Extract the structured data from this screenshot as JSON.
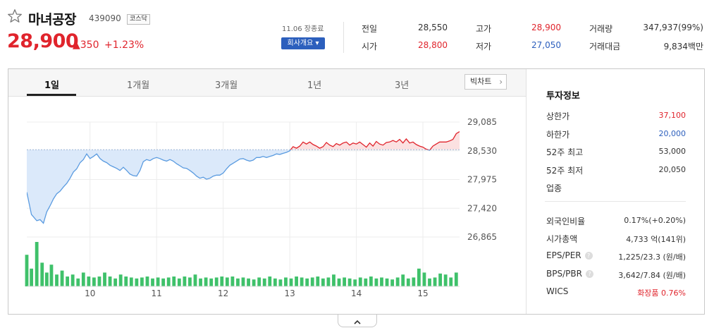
{
  "header": {
    "name": "마녀공장",
    "code": "439090",
    "market": "코스닥",
    "price": "28,900",
    "change": "▲350",
    "change_pct": "+1.23%",
    "session_date": "11.06 장종료",
    "company_button": "회사개요 ▾"
  },
  "quote": {
    "col1": [
      {
        "label": "전일",
        "value": "28,550",
        "color": "#333333"
      },
      {
        "label": "시가",
        "value": "28,800",
        "color": "#e0242c"
      }
    ],
    "col2": [
      {
        "label": "고가",
        "value": "28,900",
        "color": "#e0242c"
      },
      {
        "label": "저가",
        "value": "27,050",
        "color": "#2c5fbd"
      }
    ],
    "col3": [
      {
        "label": "거래량",
        "value": "347,937(99%)",
        "color": "#333333"
      },
      {
        "label": "거래대금",
        "value": "9,834백만",
        "color": "#333333"
      }
    ]
  },
  "tabs": [
    "1일",
    "1개월",
    "3개월",
    "1년",
    "3년"
  ],
  "active_tab": "1일",
  "bigchart_label": "빅차트",
  "side_info": {
    "title": "투자정보",
    "rows1": [
      {
        "label": "상한가",
        "value": "37,100",
        "color": "#e0242c"
      },
      {
        "label": "하한가",
        "value": "20,000",
        "color": "#2c5fbd"
      },
      {
        "label": "52주 최고",
        "value": "53,000",
        "color": "#333333"
      },
      {
        "label": "52주 최저",
        "value": "20,050",
        "color": "#333333"
      },
      {
        "label": "업종",
        "value": "",
        "color": "#333333"
      }
    ],
    "rows2": [
      {
        "label": "외국인비율",
        "value": "0.17%(+0.20%)",
        "color": "#333333",
        "help": false
      },
      {
        "label": "시가총액",
        "value": "4,733 억(141위)",
        "color": "#333333",
        "help": false
      },
      {
        "label": "EPS/PER",
        "value": "1,225/23.3 (원/배)",
        "color": "#333333",
        "help": true
      },
      {
        "label": "BPS/PBR",
        "value": "3,642/7.84 (원/배)",
        "color": "#333333",
        "help": true
      },
      {
        "label": "WICS",
        "value": "화장품 0.76%",
        "color": "#e0242c",
        "help": false
      }
    ]
  },
  "colors": {
    "up": "#e0242c",
    "down": "#2c5fbd",
    "line_down": "#5a9be0",
    "fill_down": "#dbe9fa",
    "fill_up": "#fbe1e1",
    "volume": "#3fc16a"
  },
  "chart_data": {
    "type": "line",
    "title": "",
    "xlabel": "",
    "ylabel": "",
    "ylim": [
      26865,
      29085
    ],
    "yticks": [
      "29,085",
      "28,530",
      "27,975",
      "27,420",
      "26,865"
    ],
    "ytick_values": [
      29085,
      28530,
      27975,
      27420,
      26865
    ],
    "baseline": 28550,
    "xticks": [
      "10",
      "11",
      "12",
      "13",
      "14",
      "15"
    ],
    "xrange": [
      9.05,
      15.55
    ],
    "xtick_values": [
      10,
      11,
      12,
      13,
      14,
      15
    ],
    "series": [
      {
        "values": [
          [
            9.05,
            27730
          ],
          [
            9.12,
            27300
          ],
          [
            9.2,
            27180
          ],
          [
            9.25,
            27200
          ],
          [
            9.3,
            27130
          ],
          [
            9.35,
            27350
          ],
          [
            9.4,
            27470
          ],
          [
            9.45,
            27600
          ],
          [
            9.5,
            27700
          ],
          [
            9.55,
            27750
          ],
          [
            9.6,
            27830
          ],
          [
            9.65,
            27900
          ],
          [
            9.7,
            28000
          ],
          [
            9.75,
            28120
          ],
          [
            9.8,
            28180
          ],
          [
            9.85,
            28300
          ],
          [
            9.9,
            28360
          ],
          [
            9.95,
            28470
          ],
          [
            10.0,
            28380
          ],
          [
            10.05,
            28420
          ],
          [
            10.1,
            28470
          ],
          [
            10.15,
            28380
          ],
          [
            10.2,
            28330
          ],
          [
            10.25,
            28300
          ],
          [
            10.3,
            28250
          ],
          [
            10.35,
            28220
          ],
          [
            10.4,
            28190
          ],
          [
            10.45,
            28150
          ],
          [
            10.5,
            28210
          ],
          [
            10.55,
            28150
          ],
          [
            10.6,
            28080
          ],
          [
            10.65,
            28050
          ],
          [
            10.7,
            28040
          ],
          [
            10.75,
            28150
          ],
          [
            10.8,
            28320
          ],
          [
            10.85,
            28360
          ],
          [
            10.9,
            28340
          ],
          [
            10.95,
            28380
          ],
          [
            11.0,
            28400
          ],
          [
            11.05,
            28380
          ],
          [
            11.1,
            28350
          ],
          [
            11.15,
            28330
          ],
          [
            11.2,
            28360
          ],
          [
            11.25,
            28330
          ],
          [
            11.3,
            28280
          ],
          [
            11.35,
            28240
          ],
          [
            11.4,
            28200
          ],
          [
            11.45,
            28190
          ],
          [
            11.5,
            28150
          ],
          [
            11.55,
            28100
          ],
          [
            11.6,
            28040
          ],
          [
            11.65,
            28000
          ],
          [
            11.7,
            28020
          ],
          [
            11.75,
            27980
          ],
          [
            11.8,
            28000
          ],
          [
            11.85,
            28040
          ],
          [
            11.9,
            28060
          ],
          [
            11.95,
            28060
          ],
          [
            12.0,
            28100
          ],
          [
            12.05,
            28180
          ],
          [
            12.1,
            28250
          ],
          [
            12.15,
            28290
          ],
          [
            12.2,
            28330
          ],
          [
            12.25,
            28370
          ],
          [
            12.3,
            28380
          ],
          [
            12.35,
            28350
          ],
          [
            12.4,
            28330
          ],
          [
            12.45,
            28350
          ],
          [
            12.5,
            28400
          ],
          [
            12.55,
            28400
          ],
          [
            12.6,
            28420
          ],
          [
            12.65,
            28400
          ],
          [
            12.7,
            28420
          ],
          [
            12.75,
            28440
          ],
          [
            12.8,
            28470
          ],
          [
            12.85,
            28460
          ],
          [
            12.9,
            28480
          ],
          [
            12.95,
            28500
          ],
          [
            13.0,
            28530
          ],
          [
            13.05,
            28610
          ],
          [
            13.1,
            28580
          ],
          [
            13.15,
            28620
          ],
          [
            13.2,
            28700
          ],
          [
            13.25,
            28660
          ],
          [
            13.3,
            28700
          ],
          [
            13.35,
            28650
          ],
          [
            13.4,
            28620
          ],
          [
            13.45,
            28580
          ],
          [
            13.5,
            28610
          ],
          [
            13.55,
            28690
          ],
          [
            13.6,
            28640
          ],
          [
            13.65,
            28610
          ],
          [
            13.7,
            28670
          ],
          [
            13.75,
            28640
          ],
          [
            13.8,
            28680
          ],
          [
            13.85,
            28700
          ],
          [
            13.9,
            28640
          ],
          [
            13.95,
            28680
          ],
          [
            14.0,
            28660
          ],
          [
            14.05,
            28700
          ],
          [
            14.1,
            28650
          ],
          [
            14.15,
            28600
          ],
          [
            14.2,
            28680
          ],
          [
            14.25,
            28620
          ],
          [
            14.3,
            28710
          ],
          [
            14.35,
            28660
          ],
          [
            14.4,
            28640
          ],
          [
            14.45,
            28690
          ],
          [
            14.5,
            28700
          ],
          [
            14.55,
            28730
          ],
          [
            14.6,
            28700
          ],
          [
            14.65,
            28750
          ],
          [
            14.7,
            28680
          ],
          [
            14.75,
            28760
          ],
          [
            14.8,
            28680
          ],
          [
            14.85,
            28700
          ],
          [
            14.9,
            28650
          ],
          [
            14.95,
            28620
          ],
          [
            15.0,
            28600
          ],
          [
            15.05,
            28560
          ],
          [
            15.1,
            28540
          ],
          [
            15.15,
            28620
          ],
          [
            15.2,
            28660
          ],
          [
            15.25,
            28700
          ],
          [
            15.3,
            28700
          ],
          [
            15.35,
            28700
          ],
          [
            15.4,
            28720
          ],
          [
            15.45,
            28750
          ],
          [
            15.5,
            28860
          ],
          [
            15.55,
            28900
          ]
        ]
      }
    ],
    "volume": [
      [
        9.05,
        32
      ],
      [
        9.12,
        18
      ],
      [
        9.2,
        45
      ],
      [
        9.28,
        24
      ],
      [
        9.35,
        14
      ],
      [
        9.42,
        22
      ],
      [
        9.5,
        12
      ],
      [
        9.58,
        16
      ],
      [
        9.66,
        10
      ],
      [
        9.74,
        12
      ],
      [
        9.82,
        8
      ],
      [
        9.9,
        14
      ],
      [
        9.98,
        10
      ],
      [
        10.06,
        9
      ],
      [
        10.14,
        10
      ],
      [
        10.22,
        14
      ],
      [
        10.3,
        10
      ],
      [
        10.38,
        8
      ],
      [
        10.46,
        12
      ],
      [
        10.54,
        10
      ],
      [
        10.62,
        9
      ],
      [
        10.7,
        8
      ],
      [
        10.78,
        9
      ],
      [
        10.86,
        10
      ],
      [
        10.94,
        8
      ],
      [
        11.02,
        9
      ],
      [
        11.1,
        8
      ],
      [
        11.18,
        9
      ],
      [
        11.26,
        10
      ],
      [
        11.34,
        8
      ],
      [
        11.42,
        10
      ],
      [
        11.5,
        9
      ],
      [
        11.58,
        12
      ],
      [
        11.66,
        8
      ],
      [
        11.74,
        9
      ],
      [
        11.82,
        8
      ],
      [
        11.9,
        9
      ],
      [
        11.98,
        10
      ],
      [
        12.06,
        9
      ],
      [
        12.14,
        10
      ],
      [
        12.22,
        8
      ],
      [
        12.3,
        9
      ],
      [
        12.38,
        8
      ],
      [
        12.46,
        7
      ],
      [
        12.54,
        9
      ],
      [
        12.62,
        8
      ],
      [
        12.7,
        10
      ],
      [
        12.78,
        8
      ],
      [
        12.86,
        7
      ],
      [
        12.94,
        9
      ],
      [
        13.02,
        8
      ],
      [
        13.1,
        10
      ],
      [
        13.18,
        9
      ],
      [
        13.26,
        8
      ],
      [
        13.34,
        9
      ],
      [
        13.42,
        10
      ],
      [
        13.5,
        8
      ],
      [
        13.58,
        9
      ],
      [
        13.66,
        12
      ],
      [
        13.74,
        8
      ],
      [
        13.82,
        9
      ],
      [
        13.9,
        8
      ],
      [
        13.98,
        7
      ],
      [
        14.06,
        9
      ],
      [
        14.14,
        8
      ],
      [
        14.22,
        10
      ],
      [
        14.3,
        8
      ],
      [
        14.38,
        9
      ],
      [
        14.46,
        8
      ],
      [
        14.54,
        7
      ],
      [
        14.62,
        9
      ],
      [
        14.7,
        12
      ],
      [
        14.78,
        8
      ],
      [
        14.86,
        9
      ],
      [
        14.94,
        18
      ],
      [
        15.02,
        14
      ],
      [
        15.1,
        8
      ],
      [
        15.18,
        9
      ],
      [
        15.26,
        13
      ],
      [
        15.34,
        12
      ],
      [
        15.42,
        9
      ],
      [
        15.5,
        14
      ]
    ]
  }
}
